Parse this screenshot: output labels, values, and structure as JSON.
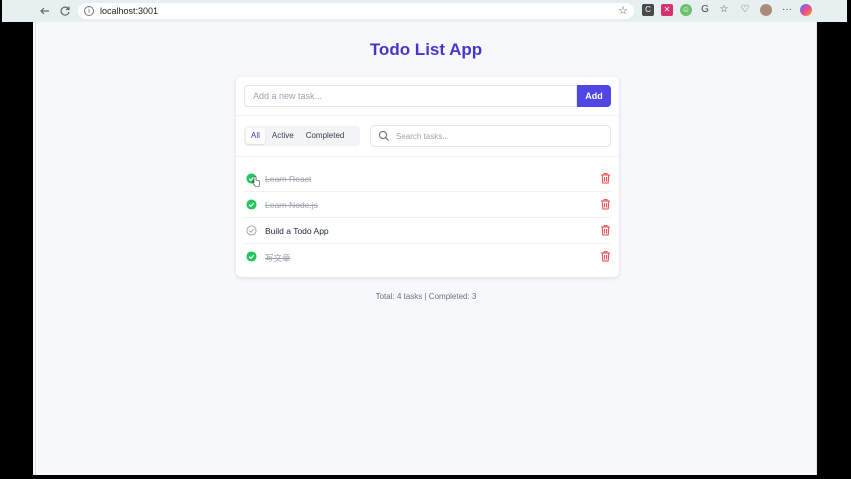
{
  "browser": {
    "url": "localhost:3001"
  },
  "app": {
    "title": "Todo List App"
  },
  "add": {
    "placeholder": "Add a new task...",
    "button_label": "Add"
  },
  "filters": [
    {
      "label": "All",
      "active": true
    },
    {
      "label": "Active",
      "active": false
    },
    {
      "label": "Completed",
      "active": false
    }
  ],
  "search": {
    "placeholder": "Search tasks..."
  },
  "tasks": [
    {
      "label": "Learn React",
      "completed": true
    },
    {
      "label": "Learn Node.js",
      "completed": true
    },
    {
      "label": "Build a Todo App",
      "completed": false
    },
    {
      "label": "写文章",
      "completed": true
    }
  ],
  "footer": {
    "summary": "Total: 4 tasks | Completed: 3"
  },
  "colors": {
    "accent": "#4f46e5",
    "title": "#4338ca",
    "done": "#22c55e",
    "delete": "#ef4444"
  }
}
